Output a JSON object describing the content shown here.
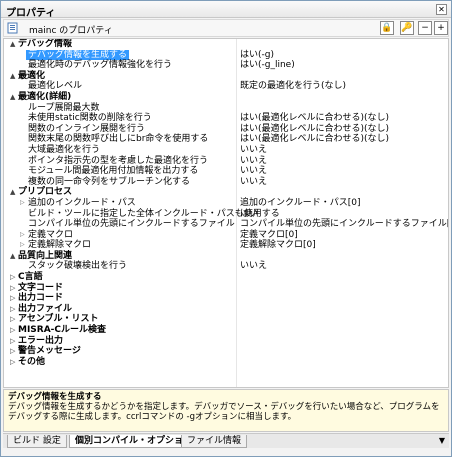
{
  "panel": {
    "title": "プロパティ",
    "close_glyph": "✕"
  },
  "toolbar": {
    "object_label": "mainc のプロパティ",
    "lock_glyph": "🔒",
    "key_glyph": "🔑",
    "minus_glyph": "−",
    "plus_glyph": "+"
  },
  "grid": {
    "rows": [
      {
        "kind": "cat",
        "toggle": "▲",
        "label": "デバッグ情報",
        "value": ""
      },
      {
        "kind": "item",
        "label": "デバッグ情報を生成する",
        "value": "はい(-g)",
        "selected": true
      },
      {
        "kind": "item",
        "label": "最適化時のデバッグ情報強化を行う",
        "value": "はい(-g_line)"
      },
      {
        "kind": "cat",
        "toggle": "▲",
        "label": "最適化",
        "value": ""
      },
      {
        "kind": "item",
        "label": "最適化レベル",
        "value": "既定の最適化を行う(なし)"
      },
      {
        "kind": "cat",
        "toggle": "▲",
        "label": "最適化(詳細)",
        "value": ""
      },
      {
        "kind": "item",
        "label": "ループ展開最大数",
        "value": ""
      },
      {
        "kind": "item",
        "label": "未使用static関数の削除を行う",
        "value": "はい(最適化レベルに合わせる)(なし)"
      },
      {
        "kind": "item",
        "label": "関数のインライン展開を行う",
        "value": "はい(最適化レベルに合わせる)(なし)"
      },
      {
        "kind": "item",
        "label": "関数末尾の関数呼び出しにbr命令を使用する",
        "value": "はい(最適化レベルに合わせる)(なし)"
      },
      {
        "kind": "item",
        "label": "大域最適化を行う",
        "value": "いいえ"
      },
      {
        "kind": "item",
        "label": "ポインタ指示先の型を考慮した最適化を行う",
        "value": "いいえ"
      },
      {
        "kind": "item",
        "label": "モジュール間最適化用付加情報を出力する",
        "value": "いいえ"
      },
      {
        "kind": "item",
        "label": "複数の同一命令列をサブルーチン化する",
        "value": "いいえ"
      },
      {
        "kind": "cat",
        "toggle": "▲",
        "label": "プリプロセス",
        "value": ""
      },
      {
        "kind": "sub",
        "label": "追加のインクルード・パス",
        "value": "追加のインクルード・パス[0]"
      },
      {
        "kind": "item",
        "label": "ビルド・ツールに指定した全体インクルード・パスも使用する",
        "value": "はい"
      },
      {
        "kind": "item",
        "label": "コンパイル単位の先頭にインクルードするファイル",
        "value": "コンパイル単位の先頭にインクルードするファイル[0]"
      },
      {
        "kind": "sub",
        "label": "定義マクロ",
        "value": "定義マクロ[0]"
      },
      {
        "kind": "sub",
        "label": "定義解除マクロ",
        "value": "定義解除マクロ[0]"
      },
      {
        "kind": "cat",
        "toggle": "▲",
        "label": "品質向上関連",
        "value": ""
      },
      {
        "kind": "item",
        "label": "スタック破壊検出を行う",
        "value": "いいえ"
      },
      {
        "kind": "cat",
        "toggle": "▷",
        "label": "C言語",
        "value": ""
      },
      {
        "kind": "cat",
        "toggle": "▷",
        "label": "文字コード",
        "value": ""
      },
      {
        "kind": "cat",
        "toggle": "▷",
        "label": "出力コード",
        "value": ""
      },
      {
        "kind": "cat",
        "toggle": "▷",
        "label": "出力ファイル",
        "value": ""
      },
      {
        "kind": "cat",
        "toggle": "▷",
        "label": "アセンブル・リスト",
        "value": ""
      },
      {
        "kind": "cat",
        "toggle": "▷",
        "label": "MISRA-Cルール検査",
        "value": ""
      },
      {
        "kind": "cat",
        "toggle": "▷",
        "label": "エラー出力",
        "value": ""
      },
      {
        "kind": "cat",
        "toggle": "▷",
        "label": "警告メッセージ",
        "value": ""
      },
      {
        "kind": "cat",
        "toggle": "▷",
        "label": "その他",
        "value": ""
      }
    ]
  },
  "description": {
    "heading": "デバッグ情報を生成する",
    "body": "デバッグ情報を生成するかどうかを指定します。デバッガでソース・デバッグを行いたい場合など、プログラムをデバッグする際に生成します。ccrlコマンドの -gオプションに相当します。"
  },
  "tabs": [
    {
      "label": "ビルド 設定",
      "active": false
    },
    {
      "label": "個別コンパイル・オプション",
      "active": true
    },
    {
      "label": "ファイル情報",
      "active": false
    }
  ],
  "tabs_dropdown_glyph": "▼"
}
